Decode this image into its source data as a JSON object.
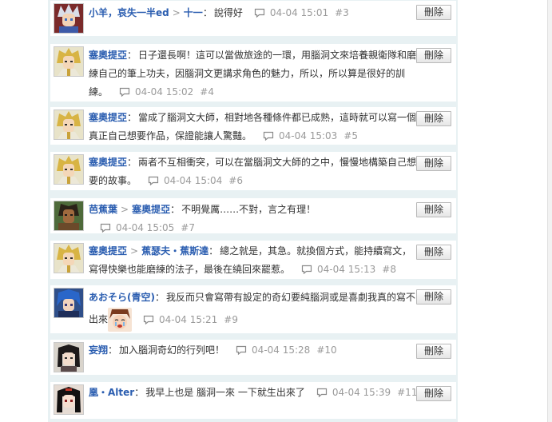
{
  "delete_label": "刪除",
  "arrow": ">",
  "colon": "：",
  "comments": [
    {
      "author": "小羊，哀失一半ed",
      "reply_to": "十一",
      "text": "說得好",
      "time": "04-04 15:01",
      "floor": "#3",
      "avatar": "silver-hair-boy"
    },
    {
      "author": "塞奧提亞",
      "reply_to": "",
      "text": "日子還長啊！這可以當做旅途的一環，用腦洞文來培養親衛隊和磨練自己的筆上功夫，因腦洞文更講求角色的魅力，所以，所以算是很好的訓練。",
      "time": "04-04 15:02",
      "floor": "#4",
      "avatar": "blonde-mage"
    },
    {
      "author": "塞奧提亞",
      "reply_to": "",
      "text": "當成了腦洞文大師，相對地各種條件都已成熟，這時就可以寫一個真正自己想要作品，保證能讓人驚豔。",
      "time": "04-04 15:03",
      "floor": "#5",
      "avatar": "blonde-mage"
    },
    {
      "author": "塞奧提亞",
      "reply_to": "",
      "text": "兩者不互相衝突，可以在當腦洞文大師的之中，慢慢地構築自己想要的故事。",
      "time": "04-04 15:04",
      "floor": "#6",
      "avatar": "blonde-mage"
    },
    {
      "author": "芭蕉葉",
      "reply_to": "塞奧提亞",
      "text": "不明覺厲……不對，言之有理！",
      "time": "04-04 15:05",
      "floor": "#7",
      "avatar": "dark-warrior"
    },
    {
      "author": "塞奧提亞",
      "reply_to": "蕉瑟夫・蕉斯達",
      "text": "總之就是，其急。就換個方式，能持續寫文，寫得快樂也能磨練的法子，最後在繞回來罷惹。",
      "time": "04-04 15:13",
      "floor": "#8",
      "avatar": "blonde-mage"
    },
    {
      "author": "あおそら(青空)",
      "reply_to": "",
      "text": "我反而只會寫帶有設定的奇幻要純腦洞或是喜劇我真的寫不出來",
      "time": "04-04 15:21",
      "floor": "#9",
      "avatar": "blue-hair-anime",
      "emoji": "crying-face"
    },
    {
      "author": "妄翔",
      "reply_to": "",
      "text": "加入腦洞奇幻的行列吧！",
      "time": "04-04 15:28",
      "floor": "#10",
      "avatar": "dark-hair-girl"
    },
    {
      "author": "凰・Alter",
      "reply_to": "",
      "text": "我早上也是 腦洞一來 一下就生出來了",
      "time": "04-04 15:39",
      "floor": "#11",
      "avatar": "black-hair-girl"
    }
  ]
}
